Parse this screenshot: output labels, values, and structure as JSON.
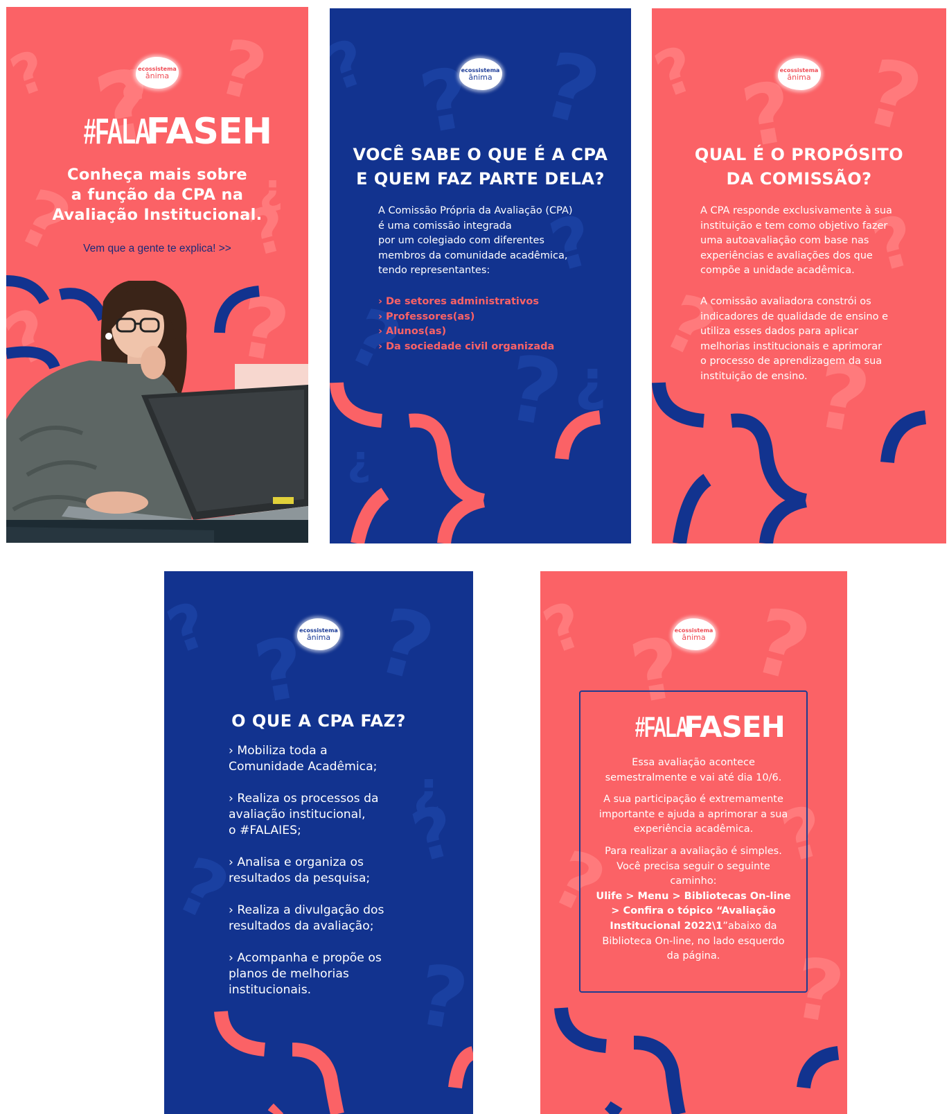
{
  "logo": {
    "line1": "ecossistema",
    "line2": "ânima"
  },
  "colors": {
    "coral": "#fb6266",
    "navy": "#12338f",
    "white": "#ffffff"
  },
  "panel1": {
    "brand_hash": "#FALA",
    "brand_name": "FASEH",
    "headline": [
      "Conheça mais sobre",
      "a função da CPA na",
      "Avaliação Institucional."
    ],
    "cta": "Vem que a gente te explica! >>"
  },
  "panel2": {
    "title": [
      "VOCÊ SABE O QUE É A CPA",
      "E QUEM FAZ PARTE DELA?"
    ],
    "body": [
      "A Comissão Própria da Avaliação (CPA)",
      "é uma comissão integrada",
      "por um colegiado com diferentes",
      "membros da comunidade acadêmica,",
      "tendo representantes:"
    ],
    "list": [
      "› De setores administrativos",
      "› Professores(as)",
      "› Alunos(as)",
      "› Da sociedade civil organizada"
    ]
  },
  "panel3": {
    "title": [
      "QUAL É O PROPÓSITO",
      "DA COMISSÃO?"
    ],
    "para1": [
      "A CPA responde exclusivamente à sua",
      "instituição e tem como objetivo fazer",
      "uma autoavaliação com base nas",
      "experiências e avaliações dos que",
      "compõe a unidade acadêmica."
    ],
    "para2": [
      "A comissão avaliadora constrói os",
      "indicadores de qualidade de ensino e",
      "utiliza esses dados para aplicar",
      "melhorias institucionais e aprimorar",
      "o processo de aprendizagem da sua",
      "instituição de ensino."
    ]
  },
  "panel4": {
    "title": "O QUE A CPA FAZ?",
    "items": [
      [
        "› Mobiliza toda a",
        "Comunidade Acadêmica;"
      ],
      [
        "› Realiza os processos da",
        "avaliação institucional,",
        "o #FALAIES;"
      ],
      [
        "› Analisa e organiza os",
        "resultados da pesquisa;"
      ],
      [
        "› Realiza a divulgação dos",
        "resultados da avaliação;"
      ],
      [
        "› Acompanha e propõe os",
        "planos de melhorias",
        "institucionais."
      ]
    ]
  },
  "panel5": {
    "brand_hash": "#FALA",
    "brand_name": "FASEH",
    "para1": [
      "Essa avaliação acontece",
      "semestralmente e vai até dia 10/6."
    ],
    "para2": [
      "A sua participação é extremamente",
      "importante e ajuda a aprimorar a sua",
      "experiência acadêmica."
    ],
    "para3": [
      "Para realizar a avaliação é simples.",
      "Você precisa seguir o seguinte",
      "caminho:"
    ],
    "path_bold": [
      "Ulife > Menu > Bibliotecas On-line",
      "> Confira o tópico “Avaliação"
    ],
    "path_bold_last": "Institucional 2022\\1",
    "path_rest": "”abaixo da",
    "path_tail": [
      "Biblioteca On-line, no lado esquerdo",
      "da página."
    ]
  }
}
